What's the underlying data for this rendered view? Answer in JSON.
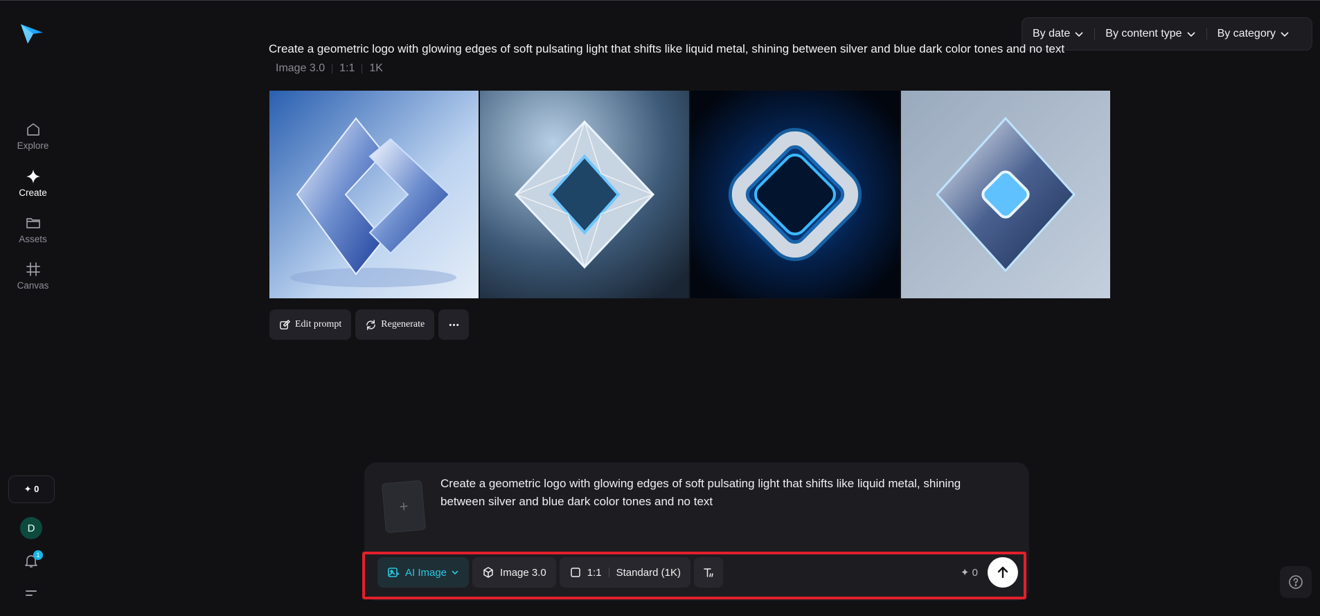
{
  "sidebar": {
    "items": [
      {
        "label": "Explore",
        "icon": "home-icon"
      },
      {
        "label": "Create",
        "icon": "sparkle-icon"
      },
      {
        "label": "Assets",
        "icon": "folder-icon"
      },
      {
        "label": "Canvas",
        "icon": "canvas-icon"
      }
    ],
    "credits": "✦ 0",
    "avatar_letter": "D",
    "notification_count": "1"
  },
  "filters": {
    "by_date": "By date",
    "by_content_type": "By content type",
    "by_category": "By category"
  },
  "generation": {
    "prompt": "Create a geometric logo with glowing edges of soft pulsating light that shifts like liquid metal, shining between silver and blue dark color tones and no text",
    "model": "Image 3.0",
    "ratio": "1:1",
    "resolution": "1K"
  },
  "actions": {
    "edit_prompt": "Edit prompt",
    "regenerate": "Regenerate"
  },
  "composer": {
    "text": "Create a geometric logo with glowing edges of soft pulsating light that shifts like liquid metal, shining between silver and blue dark color tones and no text",
    "mode": "AI Image",
    "model": "Image 3.0",
    "ratio": "1:1",
    "quality": "Standard (1K)",
    "credits": "✦ 0",
    "ref_plus": "+"
  },
  "colors": {
    "accent": "#2bc7e0",
    "background": "#111114",
    "highlight_outline": "#e0202c"
  }
}
